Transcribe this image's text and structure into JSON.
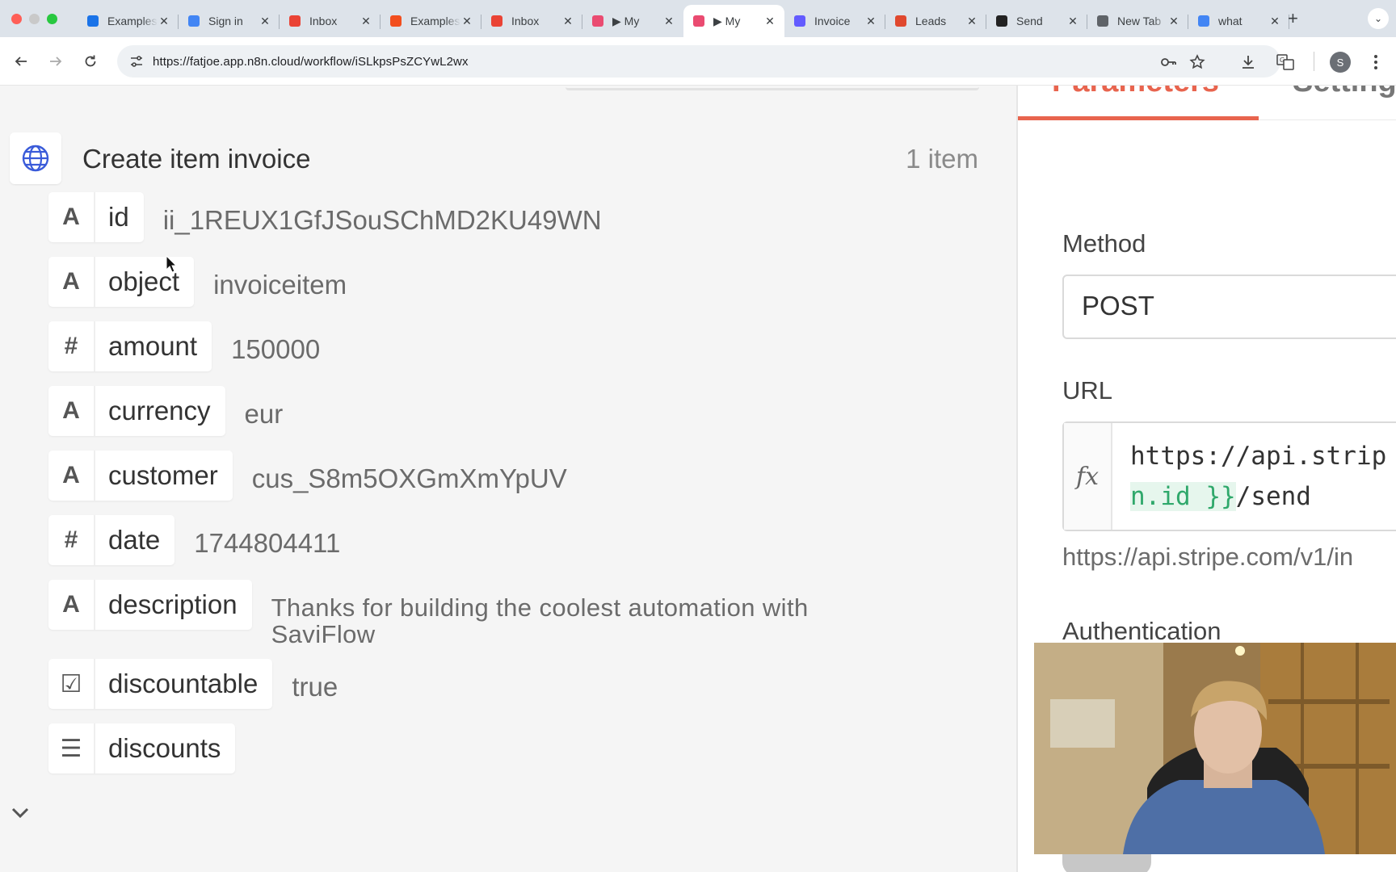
{
  "browser": {
    "tabs": [
      {
        "title": "Examples",
        "favicon": "drive-icon",
        "color": "#1a73e8",
        "active": false
      },
      {
        "title": "Sign in",
        "favicon": "google-icon",
        "color": "#4285f4",
        "active": false
      },
      {
        "title": "Inbox",
        "favicon": "gmail-icon",
        "color": "#ea4335",
        "active": false
      },
      {
        "title": "Examples",
        "favicon": "figma-icon",
        "color": "#f24e1e",
        "active": false
      },
      {
        "title": "Inbox",
        "favicon": "gmail-icon",
        "color": "#ea4335",
        "active": false
      },
      {
        "title": "▶ My",
        "favicon": "n8n-icon",
        "color": "#ea4b71",
        "active": false
      },
      {
        "title": "▶ My",
        "favicon": "n8n-icon",
        "color": "#ea4b71",
        "active": true
      },
      {
        "title": "Invoice",
        "favicon": "stripe-icon",
        "color": "#635bff",
        "active": false
      },
      {
        "title": "Leads",
        "favicon": "clay-icon",
        "color": "#e0482e",
        "active": false
      },
      {
        "title": "Send",
        "favicon": "stripe-dark-icon",
        "color": "#222222",
        "active": false
      },
      {
        "title": "New Tab",
        "favicon": "chrome-icon",
        "color": "#5f6368",
        "active": false
      },
      {
        "title": "what",
        "favicon": "google-icon",
        "color": "#4285f4",
        "active": false
      }
    ],
    "url": "https://fatjoe.app.n8n.cloud/workflow/iSLkpsPsZCYwL2wx",
    "profile_initial": "S"
  },
  "output": {
    "node_title": "Create item invoice",
    "item_count": "1 item",
    "fields": [
      {
        "type": "A",
        "key": "id",
        "value": "ii_1REUX1GfJSouSChMD2KU49WN"
      },
      {
        "type": "A",
        "key": "object",
        "value": "invoiceitem"
      },
      {
        "type": "#",
        "key": "amount",
        "value": "150000"
      },
      {
        "type": "A",
        "key": "currency",
        "value": "eur"
      },
      {
        "type": "A",
        "key": "customer",
        "value": "cus_S8m5OXGmXmYpUV"
      },
      {
        "type": "#",
        "key": "date",
        "value": "1744804411"
      },
      {
        "type": "A",
        "key": "description",
        "value": "Thanks for building the coolest automation with SaviFlow"
      },
      {
        "type": "☑",
        "key": "discountable",
        "value": "true"
      },
      {
        "type": "☰",
        "key": "discounts",
        "value": ""
      }
    ]
  },
  "params": {
    "tab_parameters": "Parameters",
    "tab_settings": "Settings",
    "method_label": "Method",
    "method_value": "POST",
    "url_label": "URL",
    "url_line1": "https://api.strip",
    "url_line2_expr": "n.id }}",
    "url_line2_rest": "/send",
    "url_preview": "https://api.stripe.com/v1/in",
    "auth_label": "Authentication"
  },
  "colors": {
    "accent": "#e8644e",
    "expression_green": "#2fa86b"
  }
}
